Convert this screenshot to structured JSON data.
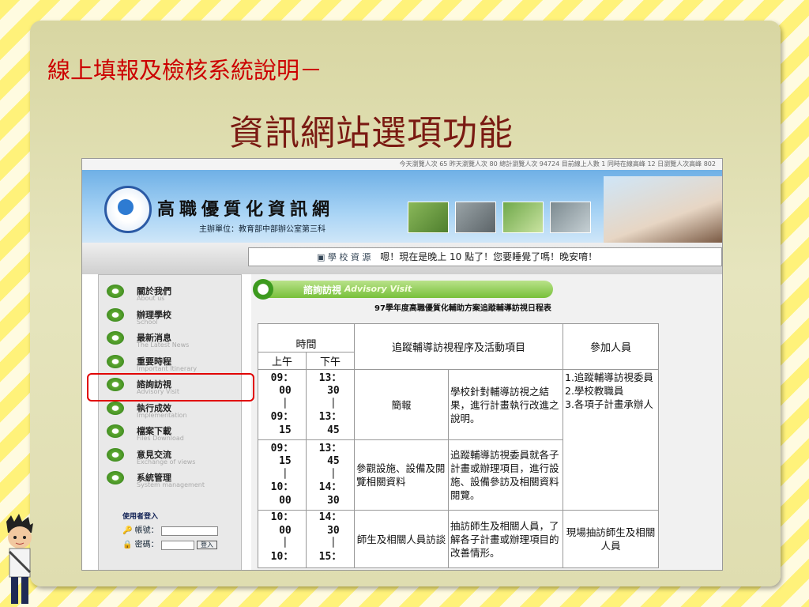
{
  "slide": {
    "title_line1": "線上填報及檢核系統說明－",
    "title_line2": "資訊網站選項功能"
  },
  "site": {
    "stats_text": "今天瀏覽人次 65 昨天瀏覽人次 80    總計瀏覽人次 94724    目前線上人數 1    同時在線高峰 12    日瀏覽人次高峰 802",
    "name": "高職優質化資訊網",
    "sponsor": "主辦單位：教育部中部辦公室第三科",
    "marquee": "嗯！現在是晚上 10 點了！您要睡覺了嗎！晚安唷！",
    "nav_icons_label": "▣ 學 校 資 源"
  },
  "sidebar": {
    "items": [
      {
        "zh": "關於我們",
        "en": "About us"
      },
      {
        "zh": "辦理學校",
        "en": "School"
      },
      {
        "zh": "最新消息",
        "en": "The Latest News"
      },
      {
        "zh": "重要時程",
        "en": "Important Itinerary"
      },
      {
        "zh": "諮詢訪視",
        "en": "Advisory Visit"
      },
      {
        "zh": "執行成效",
        "en": "Implementation"
      },
      {
        "zh": "檔案下載",
        "en": "Files Download"
      },
      {
        "zh": "意見交流",
        "en": "Exchange of views"
      },
      {
        "zh": "系統管理",
        "en": "System management"
      }
    ],
    "highlighted_index": 4,
    "login": {
      "title": "使用者登入",
      "account_label": "帳號：",
      "password_label": "密碼：",
      "button": "登入"
    }
  },
  "content": {
    "section_zh": "諮詢訪視",
    "section_en": "Advisory Visit",
    "table_title": "97學年度高職優質化輔助方案追蹤輔導訪視日程表",
    "headers": {
      "time": "時間",
      "am": "上午",
      "pm": "下午",
      "procedure": "追蹤輔導訪視程序及活動項目",
      "participants": "參加人員"
    },
    "rows": [
      {
        "am": "09：\n 00\n ｜\n09：\n 15",
        "pm": "13：\n 30\n ｜\n13：\n 45",
        "item": "簡報",
        "desc": "學校針對輔導訪視之結果，進行計畫執行改進之說明。"
      },
      {
        "am": "09：\n 15\n ｜\n10：\n 00",
        "pm": "13：\n 45\n ｜\n14：\n 30",
        "item": "參觀設施、設備及閱覽相關資料",
        "desc": "追蹤輔導訪視委員就各子計畫或辦理項目，進行設施、設備參訪及相關資料閱覽。"
      },
      {
        "am": "10：\n 00\n ｜\n10：",
        "pm": "14：\n 30\n ｜\n15：",
        "item": "師生及相關人員訪談",
        "desc": "抽訪師生及相關人員，了解各子計畫或辦理項目的改善情形。",
        "participants": "現場抽訪師生及相關人員"
      }
    ],
    "participants_merged": "1.追蹤輔導訪視委員\n2.學校教職員\n3.各項子計畫承辦人"
  },
  "colors": {
    "title_red": "#cc0000",
    "subtitle_brown": "#7a1a12",
    "highlight_box": "#e10000",
    "menu_green": "#3d9a1f"
  }
}
